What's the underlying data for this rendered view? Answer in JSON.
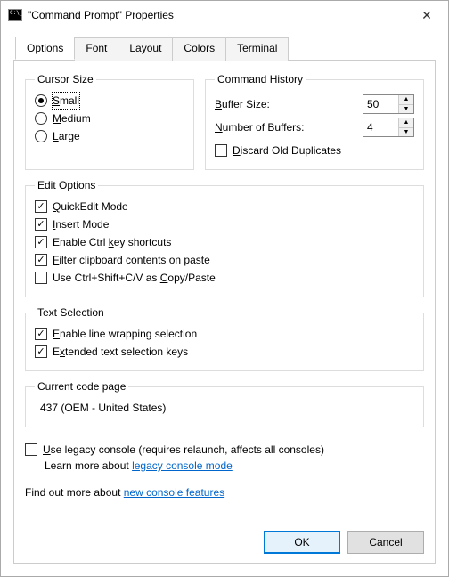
{
  "title": "\"Command Prompt\" Properties",
  "tabs": {
    "options": "Options",
    "font": "Font",
    "layout": "Layout",
    "colors": "Colors",
    "terminal": "Terminal"
  },
  "cursor": {
    "legend": "Cursor Size",
    "small": "Small",
    "medium": "Medium",
    "large": "Large",
    "selected": "small"
  },
  "history": {
    "legend": "Command History",
    "buffer_size_label_pre": "B",
    "buffer_size_label_post": "uffer Size:",
    "buffer_size_value": "50",
    "num_buffers_label_pre": "N",
    "num_buffers_label_post": "umber of Buffers:",
    "num_buffers_value": "4",
    "discard_pre": "D",
    "discard_post": "iscard Old Duplicates",
    "discard_checked": false
  },
  "edit": {
    "legend": "Edit Options",
    "quickedit_pre": "Q",
    "quickedit_post": "uickEdit Mode",
    "insert_pre": "I",
    "insert_post": "nsert Mode",
    "ctrlkey_pre1": "Enable Ctrl ",
    "ctrlkey_mn": "k",
    "ctrlkey_post": "ey shortcuts",
    "filter_mn": "F",
    "filter_post": "ilter clipboard contents on paste",
    "ctrlshift_pre": "Use Ctrl+Shift+C/V as ",
    "ctrlshift_mn": "C",
    "ctrlshift_post": "opy/Paste"
  },
  "textsel": {
    "legend": "Text Selection",
    "linewrap_pre": "E",
    "linewrap_post": "nable line wrapping selection",
    "extended_pre": "E",
    "extended_mn": "x",
    "extended_post": "tended text selection keys"
  },
  "codepage": {
    "legend": "Current code page",
    "value": "437  (OEM - United States)"
  },
  "legacy": {
    "check_mn": "U",
    "check_post": "se legacy console (requires relaunch, affects all consoles)",
    "learn_pre": "Learn more about ",
    "learn_link": "legacy console mode"
  },
  "findout": {
    "pre": "Find out more about ",
    "link": "new console features"
  },
  "buttons": {
    "ok": "OK",
    "cancel": "Cancel"
  }
}
